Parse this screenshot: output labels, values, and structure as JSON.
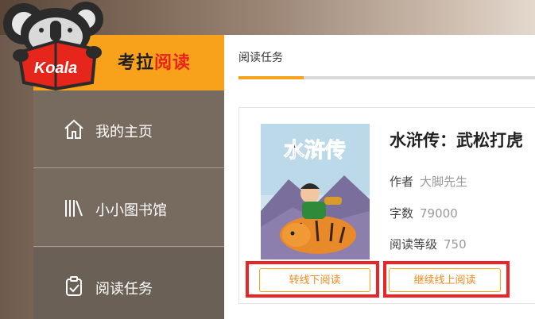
{
  "brand": {
    "logo_text": "Koala",
    "name_part1": "考拉",
    "name_part2": "阅读"
  },
  "sidebar": {
    "items": [
      {
        "label": "我的主页",
        "icon": "home-icon"
      },
      {
        "label": "小小图书馆",
        "icon": "library-icon"
      },
      {
        "label": "阅读任务",
        "icon": "task-clipboard-icon"
      }
    ]
  },
  "main": {
    "tab_label": "阅读任务",
    "book": {
      "title": "水浒传：武松打虎",
      "cover_title": "水浒传",
      "author_label": "作者",
      "author": "大脚先生",
      "words_label": "字数",
      "words": "79000",
      "level_label": "阅读等级",
      "level": "750"
    },
    "buttons": {
      "offline": "转线下阅读",
      "online": "继续线上阅读"
    }
  },
  "colors": {
    "accent": "#f7a21a",
    "highlight": "#e8262a",
    "sidebar": "#776b5f"
  }
}
